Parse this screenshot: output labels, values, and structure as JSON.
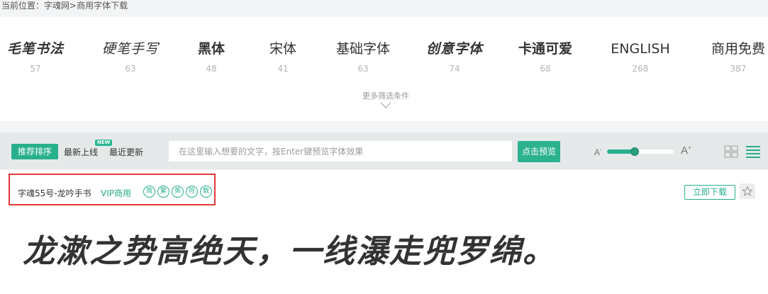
{
  "breadcrumb": {
    "prefix": "当前位置：",
    "items": [
      "字魂网",
      "商用字体下载"
    ],
    "separator": ">"
  },
  "categories": [
    {
      "name": "毛笔书法",
      "count": "57",
      "icon": "brush-calligraphy"
    },
    {
      "name": "硬笔手写",
      "count": "63",
      "icon": "pen-handwriting"
    },
    {
      "name": "黑体",
      "count": "48"
    },
    {
      "name": "宋体",
      "count": "41"
    },
    {
      "name": "基础字体",
      "count": "63"
    },
    {
      "name": "创意字体",
      "count": "74"
    },
    {
      "name": "卡通可爱",
      "count": "68"
    },
    {
      "name": "ENGLISH",
      "count": "268"
    },
    {
      "name": "商用免费",
      "count": "387"
    }
  ],
  "more_filters": {
    "label": "更多筛选条件",
    "icon": "chevron-down-icon"
  },
  "toolbar": {
    "sort_active": "推荐排序",
    "sort_newest": "最新上线",
    "new_badge": "NEW",
    "sort_updated": "最近更新",
    "search_placeholder": "在这里输入想要的文字，按Enter键预览字体效果",
    "search_value": "",
    "preview_button": "点击预览",
    "size_small_label": "A",
    "size_small_sign": "-",
    "size_large_label": "A",
    "size_large_sign": "+",
    "font_size_fraction": 0.4,
    "view_grid_icon": "grid-view-icon",
    "view_list_icon": "list-view-icon"
  },
  "font_item": {
    "name": "字魂55号-龙吟手书",
    "license": "VIP商用",
    "charsets": [
      "简",
      "繁",
      "英",
      "符",
      "数"
    ],
    "download_label": "立即下载",
    "favorite_icon": "star-icon",
    "preview_text": "龙漱之势高绝天，一线瀑走兜罗绵。"
  },
  "colors": {
    "accent": "#27b08c",
    "highlight_border": "#e23a3a",
    "page_background": "#f2f4f5",
    "toolbar_background": "#e6e9ea"
  }
}
